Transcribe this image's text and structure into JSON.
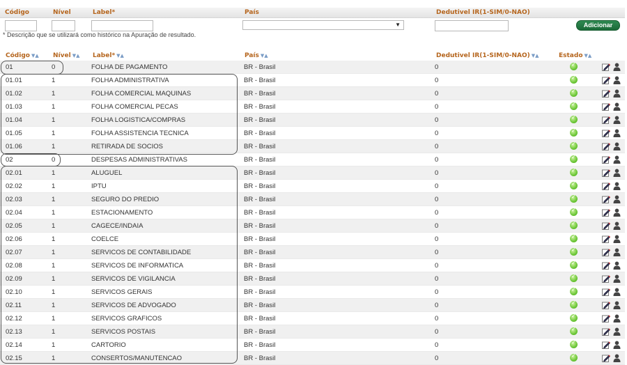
{
  "form": {
    "headers": {
      "codigo": "Código",
      "nivel": "Nível",
      "label": "Label*",
      "pais": "País",
      "dedutivel": "Dedutivel IR(1-SIM/0-NAO)"
    },
    "add_button": "Adicionar",
    "note": "* Descrição que se utilizará como histórico na Apuração de resultado."
  },
  "grid": {
    "headers": {
      "codigo": "Código",
      "nivel": "Nível",
      "label": "Label*",
      "pais": "País",
      "dedutivel": "Dedutivel IR(1-SIM/0-NAO)",
      "estado": "Estado"
    },
    "sort_glyph": "▼▲",
    "rows": [
      {
        "codigo": "01",
        "nivel": "0",
        "label": "FOLHA DE PAGAMENTO",
        "pais": "BR - Brasil",
        "dedutivel": "0"
      },
      {
        "codigo": "01.01",
        "nivel": "1",
        "label": "FOLHA ADMINISTRATIVA",
        "pais": "BR - Brasil",
        "dedutivel": "0"
      },
      {
        "codigo": "01.02",
        "nivel": "1",
        "label": "FOLHA COMERCIAL MAQUINAS",
        "pais": "BR - Brasil",
        "dedutivel": "0"
      },
      {
        "codigo": "01.03",
        "nivel": "1",
        "label": "FOLHA COMERCIAL PECAS",
        "pais": "BR - Brasil",
        "dedutivel": "0"
      },
      {
        "codigo": "01.04",
        "nivel": "1",
        "label": "FOLHA LOGISTICA/COMPRAS",
        "pais": "BR - Brasil",
        "dedutivel": "0"
      },
      {
        "codigo": "01.05",
        "nivel": "1",
        "label": "FOLHA ASSISTENCIA TECNICA",
        "pais": "BR - Brasil",
        "dedutivel": "0"
      },
      {
        "codigo": "01.06",
        "nivel": "1",
        "label": "RETIRADA DE SOCIOS",
        "pais": "BR - Brasil",
        "dedutivel": "0"
      },
      {
        "codigo": "02",
        "nivel": "0",
        "label": "DESPESAS ADMINISTRATIVAS",
        "pais": "BR - Brasil",
        "dedutivel": "0"
      },
      {
        "codigo": "02.01",
        "nivel": "1",
        "label": "ALUGUEL",
        "pais": "BR - Brasil",
        "dedutivel": "0"
      },
      {
        "codigo": "02.02",
        "nivel": "1",
        "label": "IPTU",
        "pais": "BR - Brasil",
        "dedutivel": "0"
      },
      {
        "codigo": "02.03",
        "nivel": "1",
        "label": "SEGURO DO PREDIO",
        "pais": "BR - Brasil",
        "dedutivel": "0"
      },
      {
        "codigo": "02.04",
        "nivel": "1",
        "label": "ESTACIONAMENTO",
        "pais": "BR - Brasil",
        "dedutivel": "0"
      },
      {
        "codigo": "02.05",
        "nivel": "1",
        "label": "CAGECE/INDAIA",
        "pais": "BR - Brasil",
        "dedutivel": "0"
      },
      {
        "codigo": "02.06",
        "nivel": "1",
        "label": "COELCE",
        "pais": "BR - Brasil",
        "dedutivel": "0"
      },
      {
        "codigo": "02.07",
        "nivel": "1",
        "label": "SERVICOS DE CONTABILIDADE",
        "pais": "BR - Brasil",
        "dedutivel": "0"
      },
      {
        "codigo": "02.08",
        "nivel": "1",
        "label": "SERVICOS DE INFORMATICA",
        "pais": "BR - Brasil",
        "dedutivel": "0"
      },
      {
        "codigo": "02.09",
        "nivel": "1",
        "label": "SERVICOS DE VIGILANCIA",
        "pais": "BR - Brasil",
        "dedutivel": "0"
      },
      {
        "codigo": "02.10",
        "nivel": "1",
        "label": "SERVICOS GERAIS",
        "pais": "BR - Brasil",
        "dedutivel": "0"
      },
      {
        "codigo": "02.11",
        "nivel": "1",
        "label": "SERVICOS DE ADVOGADO",
        "pais": "BR - Brasil",
        "dedutivel": "0"
      },
      {
        "codigo": "02.12",
        "nivel": "1",
        "label": "SERVICOS GRAFICOS",
        "pais": "BR - Brasil",
        "dedutivel": "0"
      },
      {
        "codigo": "02.13",
        "nivel": "1",
        "label": "SERVICOS POSTAIS",
        "pais": "BR - Brasil",
        "dedutivel": "0"
      },
      {
        "codigo": "02.14",
        "nivel": "1",
        "label": "CARTORIO",
        "pais": "BR - Brasil",
        "dedutivel": "0"
      },
      {
        "codigo": "02.15",
        "nivel": "1",
        "label": "CONSERTOS/MANUTENCAO",
        "pais": "BR - Brasil",
        "dedutivel": "0"
      }
    ]
  },
  "icons": {
    "estado": "check-circle-icon",
    "edit": "edit-pencil-icon",
    "delete": "user-icon"
  },
  "colors": {
    "header_text": "#b5651d",
    "button": "#1b6a38",
    "status_ok": "#5fbf2a"
  }
}
